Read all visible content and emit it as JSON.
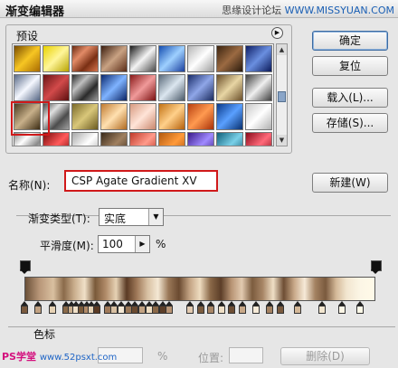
{
  "window": {
    "title": "渐变编辑器",
    "watermark": "思缘设计论坛",
    "watermark_site": "WWW.MISSYUAN.COM"
  },
  "presets": {
    "label": "预设",
    "menu_icon": "play-triangle-icon",
    "swatches": [
      {
        "id": "r0c0",
        "gradient": "linear-gradient(135deg,#7a4c00,#f7c623,#a86a00)"
      },
      {
        "id": "r0c1",
        "gradient": "linear-gradient(135deg,#e9d200,#fff69a,#b8a300)"
      },
      {
        "id": "r0c2",
        "gradient": "linear-gradient(135deg,#6a2a12,#e28b67,#7a2f14,#d7754e)"
      },
      {
        "id": "r0c3",
        "gradient": "linear-gradient(135deg,#3b1d0f,#c9a283,#5a2c16)"
      },
      {
        "id": "r0c4",
        "gradient": "linear-gradient(135deg,#1a1a1a,#f4f4f4,#4a4a4a)"
      },
      {
        "id": "r0c5",
        "gradient": "linear-gradient(135deg,#144db0,#9ed0ff,#1a3f9e)"
      },
      {
        "id": "r0c6",
        "gradient": "linear-gradient(135deg,#b5b5b5,#ffffff,#9c9c9c)"
      },
      {
        "id": "r0c7",
        "gradient": "linear-gradient(135deg,#3c2410,#9b6a42,#2a1a0c)"
      },
      {
        "id": "r0c8",
        "gradient": "linear-gradient(135deg,#0f1f66,#6a8fe0,#0b1a5a)"
      },
      {
        "id": "r1c0",
        "gradient": "linear-gradient(135deg,#5a6a88,#f5f8ff,#566684)"
      },
      {
        "id": "r1c1",
        "gradient": "linear-gradient(135deg,#6a1515,#d24a4a,#5c1010)"
      },
      {
        "id": "r1c2",
        "gradient": "linear-gradient(135deg,#2a2a2a,#c0c0c0,#2a2a2a,#9a9a9a)"
      },
      {
        "id": "r1c3",
        "gradient": "linear-gradient(135deg,#0c2a70,#7fb3ff,#0b2464)"
      },
      {
        "id": "r1c4",
        "gradient": "linear-gradient(135deg,#8a1a1a,#f09a9a,#7a1010)"
      },
      {
        "id": "r1c5",
        "gradient": "linear-gradient(135deg,#5a6a7a,#dbe6ef,#4b5a69)"
      },
      {
        "id": "r1c6",
        "gradient": "linear-gradient(135deg,#1a2d6a,#8fa6e8,#1b2b5e)"
      },
      {
        "id": "r1c7",
        "gradient": "linear-gradient(135deg,#6b4f2a,#e8d6a4,#6b4f2a)"
      },
      {
        "id": "r1c8",
        "gradient": "linear-gradient(135deg,#3f3f3f,#f0f0f0,#3f3f3f)"
      },
      {
        "id": "r2c0",
        "gradient": "linear-gradient(135deg,#4a3a20,#c8b08a,#3c2c14)"
      },
      {
        "id": "r2c1",
        "gradient": "linear-gradient(135deg,#4c4c4c,#e0e0e0,#4c4c4c,#a0a0a0)"
      },
      {
        "id": "r2c2",
        "gradient": "linear-gradient(135deg,#7a6a2a,#d9c77a,#6a5a20)"
      },
      {
        "id": "r2c3",
        "gradient": "linear-gradient(135deg,#c07a30,#ffe0b0,#b06a20)"
      },
      {
        "id": "r2c4",
        "gradient": "linear-gradient(135deg,#d79a80,#ffe4d8,#c9866c)"
      },
      {
        "id": "r2c5",
        "gradient": "linear-gradient(135deg,#c27214,#ffd08a,#b45f0a)"
      },
      {
        "id": "r2c6",
        "gradient": "linear-gradient(135deg,#b84010,#ff9a50,#a83008)"
      },
      {
        "id": "r2c7",
        "gradient": "linear-gradient(135deg,#0a3a8a,#5aa0ff,#08306e)"
      },
      {
        "id": "r2c8",
        "gradient": "linear-gradient(135deg,#c8c8c8,#ffffff,#b0b0b0)"
      },
      {
        "id": "r3c0",
        "gradient": "linear-gradient(135deg,#8a8a8a,#ffffff,#8a8a8a,#e0e0e0)"
      },
      {
        "id": "r3c1",
        "gradient": "linear-gradient(135deg,#7a0a0a,#ff5a5a,#700505)"
      },
      {
        "id": "r3c2",
        "gradient": "linear-gradient(135deg,#a8a8a8,#ffffff,#a8a8a8)"
      },
      {
        "id": "r3c3",
        "gradient": "linear-gradient(135deg,#3a2a1a,#a08060,#3a2a1a)"
      },
      {
        "id": "r3c4",
        "gradient": "linear-gradient(135deg,#c03a2a,#ff9a8a,#b02a1a)"
      },
      {
        "id": "r3c5",
        "gradient": "linear-gradient(135deg,#b25a10,#ff9a3a,#a44c08)"
      },
      {
        "id": "r3c6",
        "gradient": "linear-gradient(135deg,#3a1a8a,#a08aff,#30147a)"
      },
      {
        "id": "r3c7",
        "gradient": "linear-gradient(135deg,#10607a,#7ad0e8,#0a5066)"
      },
      {
        "id": "r3c8",
        "gradient": "linear-gradient(135deg,#8a0a1a,#ff6a7a,#7a0510)"
      }
    ]
  },
  "buttons": {
    "ok": "确定",
    "reset": "复位",
    "load": "载入(L)...",
    "save": "存储(S)...",
    "new": "新建(W)",
    "delete": "删除(D)"
  },
  "name_field": {
    "label": "名称(N):",
    "value": "CSP Agate Gradient XV"
  },
  "gradient_type": {
    "label": "渐变类型(T):",
    "value": "实底"
  },
  "smoothness": {
    "label": "平滑度(M):",
    "value": "100",
    "unit": "%"
  },
  "gradient_bar": {
    "css": "linear-gradient(90deg,#6a5038 0%,#b89678 4%,#d9c0a0 8%,#8a6a4a 11%,#c9ad8c 14%,#f0e0c8 17%,#7a5a3a 20%,#b08a68 23%,#e6d2b4 26%,#5a3a24 29%,#a07a5a 32%,#d8c0a2 35%,#f4e8d4 38%,#9a7858 41%,#6a4a30 44%,#c2a282 47%,#eedcc0 50%,#8a6848 53%,#5c3e28 56%,#b89474 59%,#e2cab0 62%,#7c5c3e 65%,#a88666 68%,#efdfc6 71%,#6e4e34 74%,#c8a888 77%,#f6ead8 80%,#a48262 83%,#7a5a3e 86%,#d4b898 89%,#f2e6d0 92%,#fcf6e6 96%,#fffae8 100%)",
    "opacity_stops_pct": [
      0,
      100
    ],
    "color_stops": [
      {
        "pos": 0,
        "color": "#7a5a3e"
      },
      {
        "pos": 4,
        "color": "#c2a282"
      },
      {
        "pos": 8,
        "color": "#e6d2b4"
      },
      {
        "pos": 12,
        "color": "#8a6a4a"
      },
      {
        "pos": 13.5,
        "color": "#c9ad8c"
      },
      {
        "pos": 15,
        "color": "#f0e0c8"
      },
      {
        "pos": 16.5,
        "color": "#7a5a3a"
      },
      {
        "pos": 18,
        "color": "#b08a68"
      },
      {
        "pos": 19.5,
        "color": "#e6d2b4"
      },
      {
        "pos": 21,
        "color": "#5a3a24"
      },
      {
        "pos": 24,
        "color": "#a07a5a"
      },
      {
        "pos": 26,
        "color": "#d8c0a2"
      },
      {
        "pos": 28,
        "color": "#f4e8d4"
      },
      {
        "pos": 30,
        "color": "#9a7858"
      },
      {
        "pos": 32,
        "color": "#6a4a30"
      },
      {
        "pos": 34,
        "color": "#c2a282"
      },
      {
        "pos": 36,
        "color": "#eedcc0"
      },
      {
        "pos": 38,
        "color": "#8a6848"
      },
      {
        "pos": 40,
        "color": "#5c3e28"
      },
      {
        "pos": 42,
        "color": "#b89474"
      },
      {
        "pos": 48,
        "color": "#e2cab0"
      },
      {
        "pos": 51,
        "color": "#7c5c3e"
      },
      {
        "pos": 54,
        "color": "#a88666"
      },
      {
        "pos": 57,
        "color": "#efdfc6"
      },
      {
        "pos": 60,
        "color": "#6e4e34"
      },
      {
        "pos": 63,
        "color": "#c8a888"
      },
      {
        "pos": 67,
        "color": "#f6ead8"
      },
      {
        "pos": 71,
        "color": "#a48262"
      },
      {
        "pos": 74,
        "color": "#7a5a3e"
      },
      {
        "pos": 79,
        "color": "#d4b898"
      },
      {
        "pos": 86,
        "color": "#f2e6d0"
      },
      {
        "pos": 92,
        "color": "#fcf6e6"
      },
      {
        "pos": 97,
        "color": "#fffae8"
      }
    ]
  },
  "color_stops_section": {
    "label": "色标",
    "percent_unit": "%",
    "position_label": "位置:"
  },
  "footer_watermark": {
    "text": "PS学堂",
    "url": "www.52psxt.com"
  }
}
